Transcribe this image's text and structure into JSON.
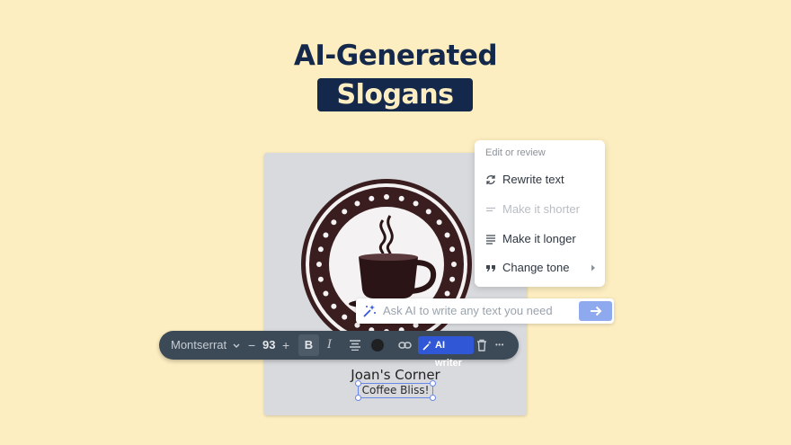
{
  "hero": {
    "title_line1": "AI-Generated",
    "title_line2": "Slogans"
  },
  "canvas": {
    "brand_name": "Joan's Corner",
    "slogan": "Coffee Bliss!",
    "logo_colors": {
      "ring": "#3a1d1f",
      "cup": "#2b1416",
      "background": "#d8dade"
    }
  },
  "toolbar": {
    "font_family": "Montserrat",
    "decrease": "−",
    "font_size": "93",
    "increase": "+",
    "bold": "B",
    "italic": "I",
    "text_color": "#1f2022",
    "ai_writer_label": "AI writer",
    "more": "•••"
  },
  "ai_prompt": {
    "placeholder": "Ask AI to write any text you need"
  },
  "edit_menu": {
    "header": "Edit or review",
    "items": [
      {
        "label": "Rewrite text",
        "icon": "refresh-icon",
        "enabled": true
      },
      {
        "label": "Make it shorter",
        "icon": "shorter-lines-icon",
        "enabled": false
      },
      {
        "label": "Make it longer",
        "icon": "longer-lines-icon",
        "enabled": true
      },
      {
        "label": "Change tone",
        "icon": "quote-icon",
        "enabled": true,
        "submenu": true
      }
    ]
  },
  "colors": {
    "page_background": "#fdeec1",
    "navy": "#13284a",
    "accent_blue": "#2f57d6",
    "toolbar_bg": "#3c4a57"
  }
}
